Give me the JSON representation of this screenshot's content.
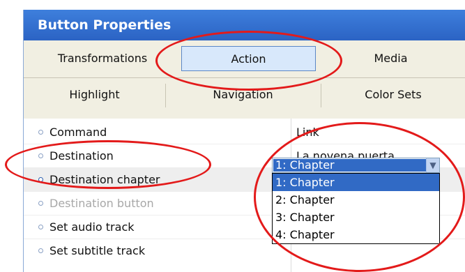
{
  "window": {
    "title": "Button Properties"
  },
  "tabs": {
    "row1": [
      "Transformations",
      "Action",
      "Media"
    ],
    "row2": [
      "Highlight",
      "Navigation",
      "Color Sets"
    ],
    "selected": "Action"
  },
  "properties": [
    {
      "key": "Command",
      "value": "Link"
    },
    {
      "key": "Destination",
      "value": "La novena puerta"
    },
    {
      "key": "Destination chapter",
      "value": "1: Chapter"
    },
    {
      "key": "Destination button",
      "value": ""
    },
    {
      "key": "Set audio track",
      "value": ""
    },
    {
      "key": "Set subtitle track",
      "value": ""
    }
  ],
  "dropdown": {
    "selected": "1: Chapter",
    "options": [
      "1: Chapter",
      "2: Chapter",
      "3: Chapter",
      "4: Chapter"
    ],
    "arrow_icon": "chevron-down-icon"
  },
  "colors": {
    "titlebar": "#2b63c4",
    "selection": "#316ac5",
    "annotation": "#e31a1a"
  }
}
